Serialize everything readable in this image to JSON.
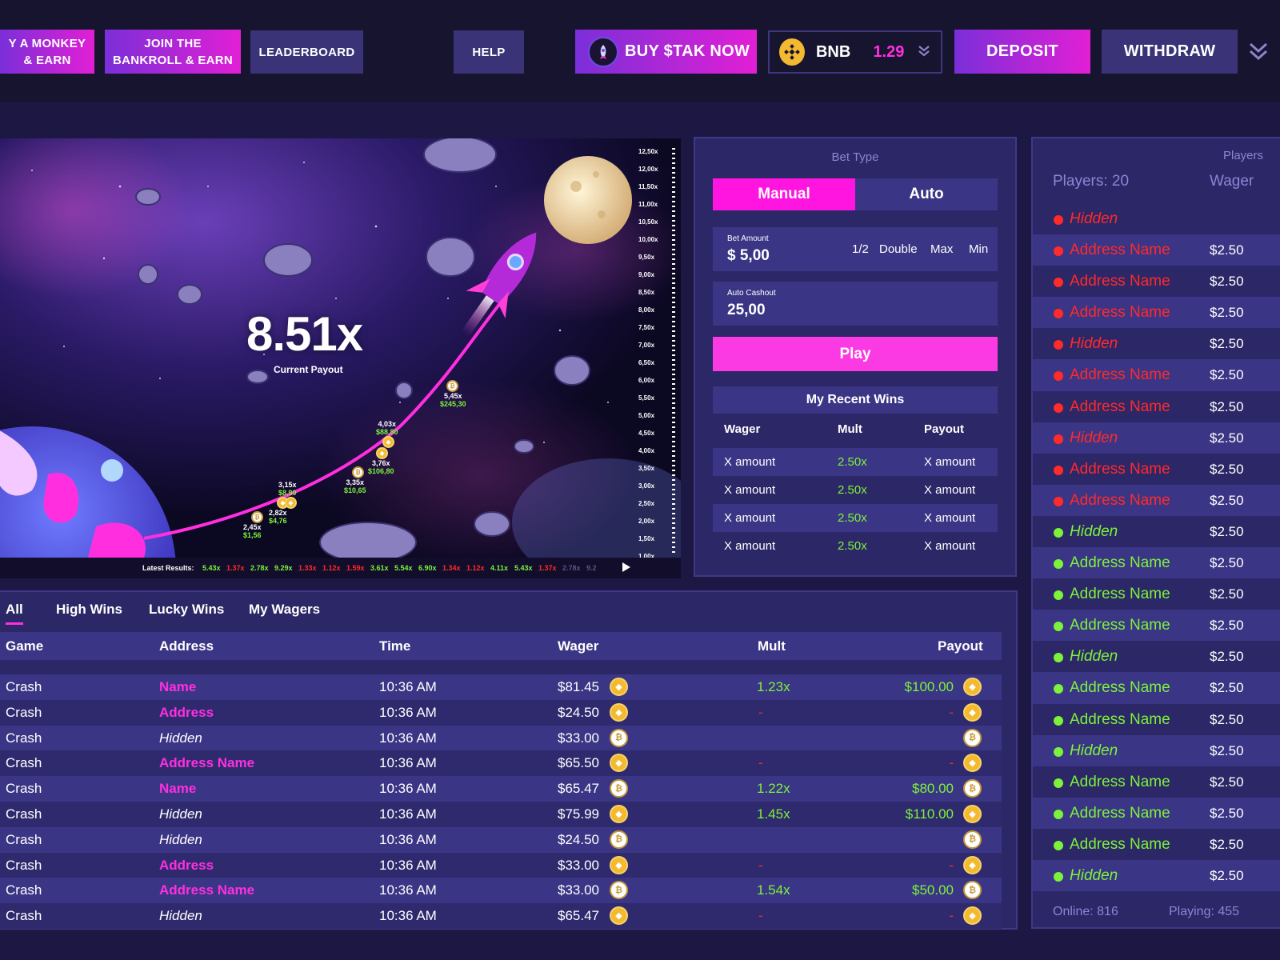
{
  "colors": {
    "magenta": "#ff2fe0",
    "green": "#7cf23a",
    "red": "#ff2a2a",
    "panel": "#2c2766"
  },
  "topbar": {
    "monkey_line1": "Y A MONKEY",
    "monkey_line2": "& EARN",
    "join_line1": "JOIN THE",
    "join_line2": "BANKROLL & EARN",
    "leaderboard": "LEADERBOARD",
    "help": "HELP",
    "buy_stak": "BUY $TAK NOW",
    "token_name": "BNB",
    "token_value": "1.29",
    "deposit": "DEPOSIT",
    "withdraw": "WITHDRAW"
  },
  "game": {
    "payout": "8.51x",
    "payout_label": "Current Payout",
    "scale": [
      "12,50x",
      "12,00x",
      "11,50x",
      "11,00x",
      "10,50x",
      "10,00x",
      "9,50x",
      "9,00x",
      "8,50x",
      "8,00x",
      "7,50x",
      "7,00x",
      "6,50x",
      "6,00x",
      "5,50x",
      "5,00x",
      "4,50x",
      "4,00x",
      "3,50x",
      "3,00x",
      "2,50x",
      "2,00x",
      "1,50x",
      "1,00x"
    ],
    "points": [
      {
        "mult": "2,45x",
        "amount": "$1,56"
      },
      {
        "mult": "2,82x",
        "amount": "$4,76"
      },
      {
        "mult": "3,15x",
        "amount": "$8,90"
      },
      {
        "mult": "3,35x",
        "amount": "$10,65"
      },
      {
        "mult": "3,76x",
        "amount": "$106,80"
      },
      {
        "mult": "4,03x",
        "amount": "$88,80"
      },
      {
        "mult": "5,45x",
        "amount": "$245,30"
      }
    ],
    "latest_label": "Latest Results:",
    "latest": [
      {
        "v": "5.43x",
        "c": "g"
      },
      {
        "v": "1.37x",
        "c": "r"
      },
      {
        "v": "2.78x",
        "c": "g"
      },
      {
        "v": "9.29x",
        "c": "g"
      },
      {
        "v": "1.33x",
        "c": "r"
      },
      {
        "v": "1.12x",
        "c": "r"
      },
      {
        "v": "1.59x",
        "c": "r"
      },
      {
        "v": "3.61x",
        "c": "g"
      },
      {
        "v": "5.54x",
        "c": "g"
      },
      {
        "v": "6.90x",
        "c": "g"
      },
      {
        "v": "1.34x",
        "c": "r"
      },
      {
        "v": "1.12x",
        "c": "r"
      },
      {
        "v": "4.11x",
        "c": "g"
      },
      {
        "v": "5.43x",
        "c": "g"
      },
      {
        "v": "1.37x",
        "c": "r"
      },
      {
        "v": "2.78x",
        "c": "d"
      },
      {
        "v": "9.2",
        "c": "d"
      }
    ]
  },
  "bet": {
    "title": "Bet Type",
    "manual": "Manual",
    "auto": "Auto",
    "amount_label": "Bet Amount",
    "amount_value": "$ 5,00",
    "half": "1/2",
    "double": "Double",
    "max": "Max",
    "min": "Min",
    "cashout_label": "Auto Cashout",
    "cashout_value": "25,00",
    "play": "Play",
    "recent_title": "My Recent Wins",
    "head_wager": "Wager",
    "head_mult": "Mult",
    "head_payout": "Payout",
    "rows": [
      {
        "wager": "X amount",
        "mult": "2.50x",
        "payout": "X amount"
      },
      {
        "wager": "X amount",
        "mult": "2.50x",
        "payout": "X amount"
      },
      {
        "wager": "X amount",
        "mult": "2.50x",
        "payout": "X amount"
      },
      {
        "wager": "X amount",
        "mult": "2.50x",
        "payout": "X amount"
      }
    ]
  },
  "bets": {
    "tabs": [
      "All",
      "High Wins",
      "Lucky Wins",
      "My Wagers"
    ],
    "headers": {
      "game": "Game",
      "address": "Address",
      "time": "Time",
      "wager": "Wager",
      "mult": "Mult",
      "payout": "Payout"
    },
    "rows": [
      {
        "game": "Crash",
        "address": "Name",
        "hidden": false,
        "time": "10:36 AM",
        "wager": "$81.45",
        "coin": "bnb",
        "mult": "1.23x",
        "payout": "$100.00",
        "pcoin": "bnb"
      },
      {
        "game": "Crash",
        "address": "Address",
        "hidden": false,
        "time": "10:36 AM",
        "wager": "$24.50",
        "coin": "bnb",
        "mult": "-",
        "payout": "-",
        "pcoin": "bnb"
      },
      {
        "game": "Crash",
        "address": "Hidden",
        "hidden": true,
        "time": "10:36 AM",
        "wager": "$33.00",
        "coin": "btc",
        "mult": "",
        "payout": "",
        "pcoin": "btc"
      },
      {
        "game": "Crash",
        "address": "Address Name",
        "hidden": false,
        "time": "10:36 AM",
        "wager": "$65.50",
        "coin": "bnb",
        "mult": "-",
        "payout": "-",
        "pcoin": "bnb"
      },
      {
        "game": "Crash",
        "address": "Name",
        "hidden": false,
        "time": "10:36 AM",
        "wager": "$65.47",
        "coin": "btc",
        "mult": "1.22x",
        "payout": "$80.00",
        "pcoin": "btc"
      },
      {
        "game": "Crash",
        "address": "Hidden",
        "hidden": true,
        "time": "10:36 AM",
        "wager": "$75.99",
        "coin": "bnb",
        "mult": "1.45x",
        "payout": "$110.00",
        "pcoin": "bnb"
      },
      {
        "game": "Crash",
        "address": "Hidden",
        "hidden": true,
        "time": "10:36 AM",
        "wager": "$24.50",
        "coin": "btc",
        "mult": "",
        "payout": "",
        "pcoin": "btc"
      },
      {
        "game": "Crash",
        "address": "Address",
        "hidden": false,
        "time": "10:36 AM",
        "wager": "$33.00",
        "coin": "bnb",
        "mult": "-",
        "payout": "-",
        "pcoin": "bnb"
      },
      {
        "game": "Crash",
        "address": "Address Name",
        "hidden": false,
        "time": "10:36 AM",
        "wager": "$33.00",
        "coin": "btc",
        "mult": "1.54x",
        "payout": "$50.00",
        "pcoin": "btc"
      },
      {
        "game": "Crash",
        "address": "Hidden",
        "hidden": true,
        "time": "10:36 AM",
        "wager": "$65.47",
        "coin": "bnb",
        "mult": "-",
        "payout": "-",
        "pcoin": "bnb"
      }
    ]
  },
  "players": {
    "title": "Players",
    "count": "Players: 20",
    "wager_head": "Wager",
    "online": "Online: 816",
    "playing": "Playing: 455",
    "list": [
      {
        "name": "Hidden",
        "hidden": true,
        "wager": "",
        "status": "red"
      },
      {
        "name": "Address Name",
        "hidden": false,
        "wager": "$2.50",
        "status": "red"
      },
      {
        "name": "Address Name",
        "hidden": false,
        "wager": "$2.50",
        "status": "red"
      },
      {
        "name": "Address Name",
        "hidden": false,
        "wager": "$2.50",
        "status": "red"
      },
      {
        "name": "Hidden",
        "hidden": true,
        "wager": "$2.50",
        "status": "red"
      },
      {
        "name": "Address Name",
        "hidden": false,
        "wager": "$2.50",
        "status": "red"
      },
      {
        "name": "Address Name",
        "hidden": false,
        "wager": "$2.50",
        "status": "red"
      },
      {
        "name": "Hidden",
        "hidden": true,
        "wager": "$2.50",
        "status": "red"
      },
      {
        "name": "Address Name",
        "hidden": false,
        "wager": "$2.50",
        "status": "red"
      },
      {
        "name": "Address Name",
        "hidden": false,
        "wager": "$2.50",
        "status": "red"
      },
      {
        "name": "Hidden",
        "hidden": true,
        "wager": "$2.50",
        "status": "green"
      },
      {
        "name": "Address Name",
        "hidden": false,
        "wager": "$2.50",
        "status": "green"
      },
      {
        "name": "Address Name",
        "hidden": false,
        "wager": "$2.50",
        "status": "green"
      },
      {
        "name": "Address Name",
        "hidden": false,
        "wager": "$2.50",
        "status": "green"
      },
      {
        "name": "Hidden",
        "hidden": true,
        "wager": "$2.50",
        "status": "green"
      },
      {
        "name": "Address Name",
        "hidden": false,
        "wager": "$2.50",
        "status": "green"
      },
      {
        "name": "Address Name",
        "hidden": false,
        "wager": "$2.50",
        "status": "green"
      },
      {
        "name": "Hidden",
        "hidden": true,
        "wager": "$2.50",
        "status": "green"
      },
      {
        "name": "Address Name",
        "hidden": false,
        "wager": "$2.50",
        "status": "green"
      },
      {
        "name": "Address Name",
        "hidden": false,
        "wager": "$2.50",
        "status": "green"
      },
      {
        "name": "Address Name",
        "hidden": false,
        "wager": "$2.50",
        "status": "green"
      },
      {
        "name": "Hidden",
        "hidden": true,
        "wager": "$2.50",
        "status": "green"
      }
    ]
  }
}
